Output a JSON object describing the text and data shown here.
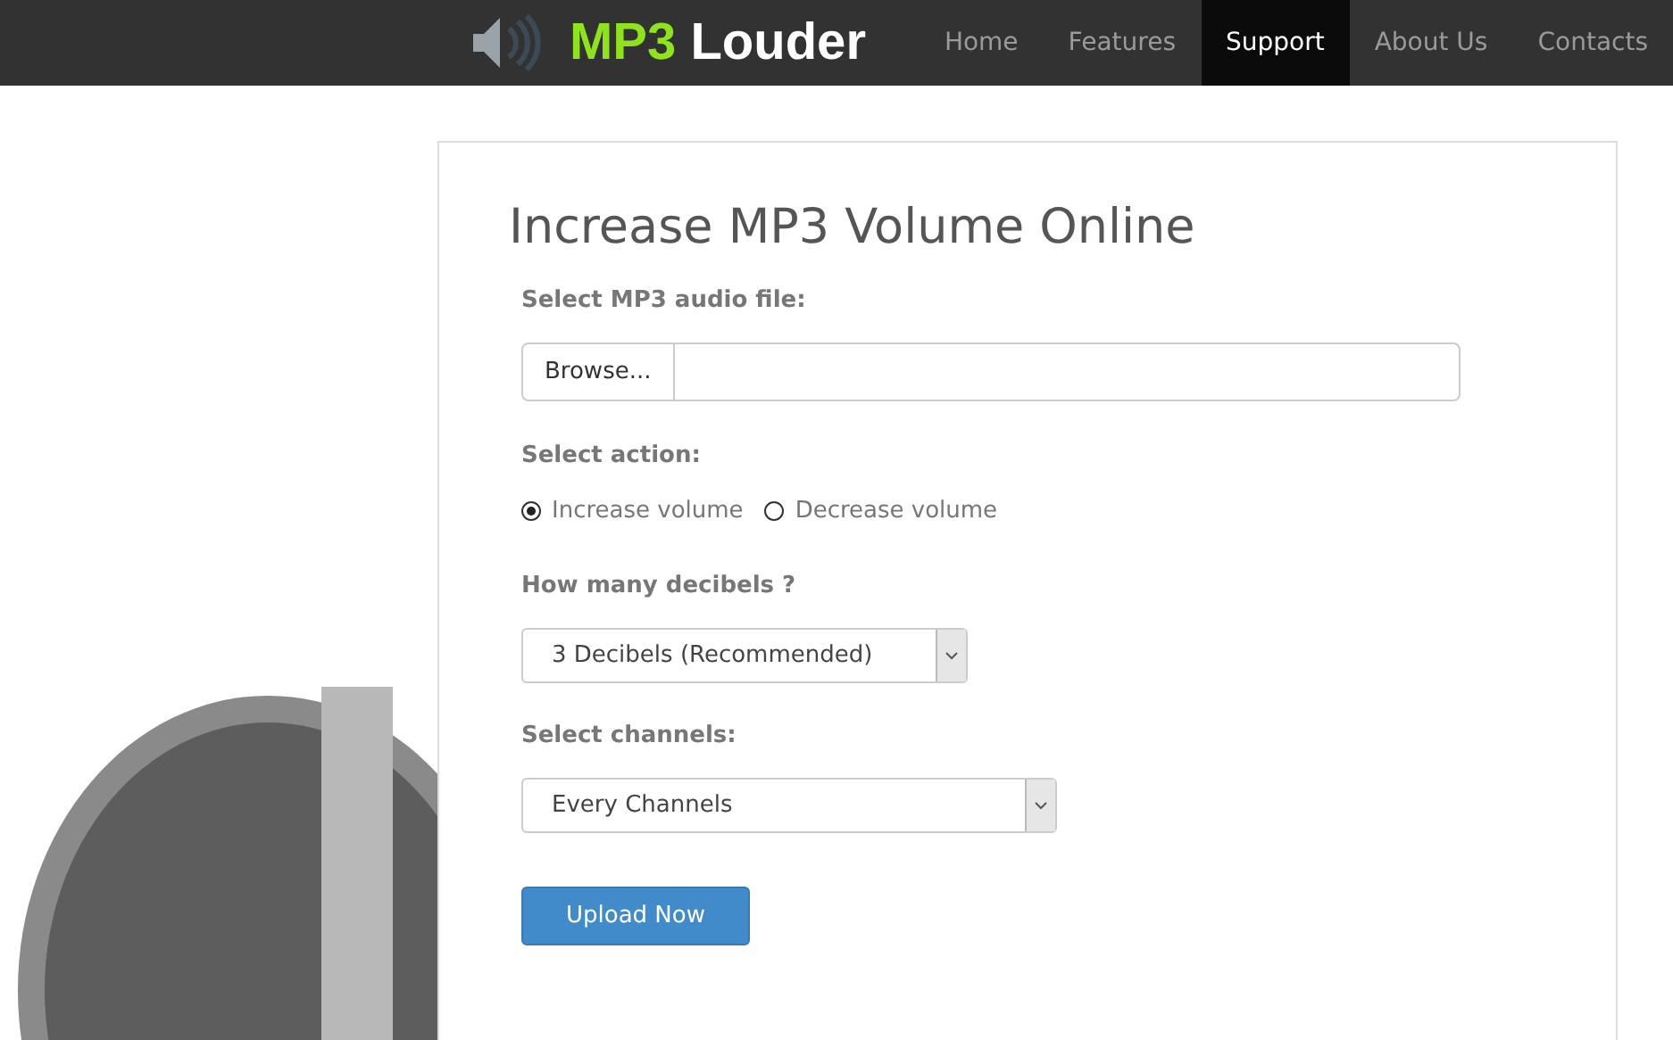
{
  "header": {
    "logo": {
      "accent": "MP3",
      "name": "Louder"
    },
    "nav": [
      {
        "label": "Home",
        "selected": false
      },
      {
        "label": "Features",
        "selected": false
      },
      {
        "label": "Support",
        "selected": true
      },
      {
        "label": "About Us",
        "selected": false
      },
      {
        "label": "Contacts",
        "selected": false
      }
    ]
  },
  "form": {
    "title": "Increase MP3 Volume Online",
    "file": {
      "label": "Select MP3 audio file:",
      "button": "Browse..."
    },
    "action": {
      "label": "Select action:",
      "options": [
        {
          "label": "Increase volume",
          "selected": true
        },
        {
          "label": "Decrease volume",
          "selected": false
        }
      ]
    },
    "decibels": {
      "label": "How many decibels ?",
      "value": "3 Decibels (Recommended)"
    },
    "channels": {
      "label": "Select channels:",
      "value": "Every Channels"
    },
    "submit": "Upload Now"
  }
}
